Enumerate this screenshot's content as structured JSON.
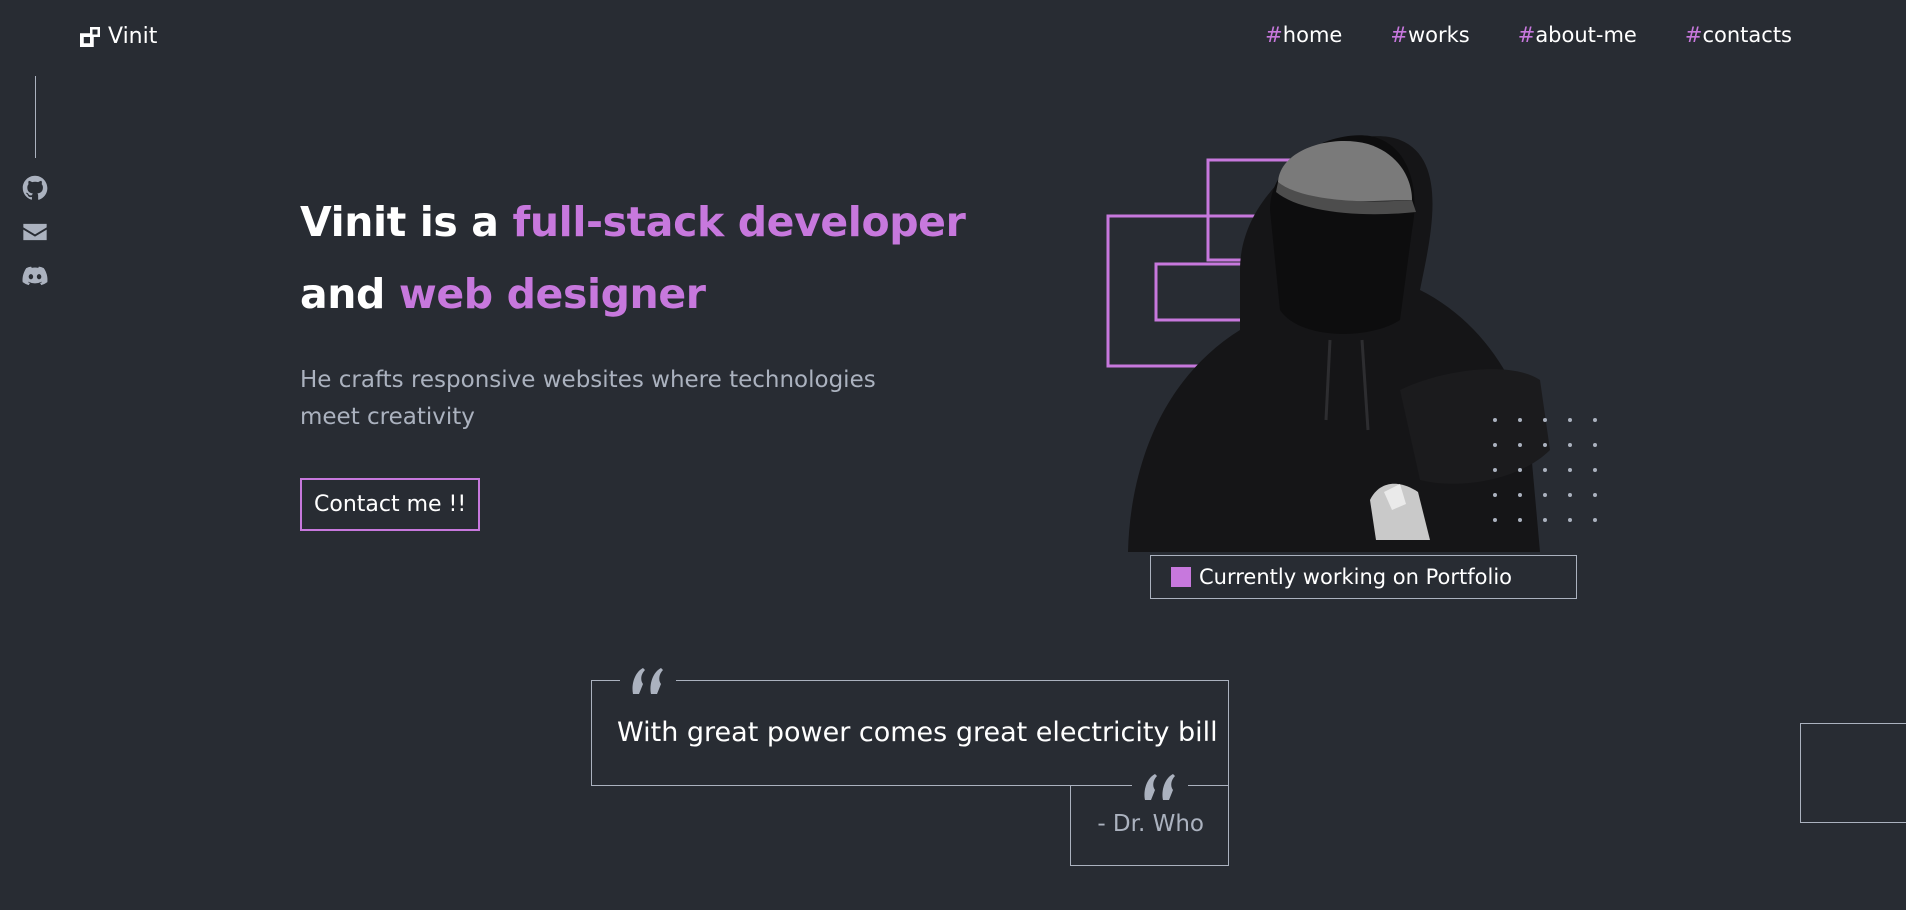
{
  "brand": {
    "name": "Vinit",
    "logo_icon": "logo-icon"
  },
  "nav": {
    "items": [
      {
        "hash": "#",
        "label": "home"
      },
      {
        "hash": "#",
        "label": "works"
      },
      {
        "hash": "#",
        "label": "about-me"
      },
      {
        "hash": "#",
        "label": "contacts"
      }
    ]
  },
  "social": {
    "icons": [
      "github-icon",
      "email-icon",
      "discord-icon"
    ]
  },
  "hero": {
    "title_parts": {
      "p1": "Vinit is a ",
      "p2": "full-stack developer",
      "p3": " and ",
      "p4": "web designer"
    },
    "subtitle": "He crafts responsive websites where technologies meet creativity",
    "cta_label": "Contact me !!"
  },
  "status": {
    "text": "Currently working on Portfolio"
  },
  "quote": {
    "text": "With great power comes great electricity bill",
    "author": "- Dr. Who"
  },
  "colors": {
    "background": "#282c33",
    "accent": "#c778dd",
    "text": "#ffffff",
    "muted": "#abb2bf"
  }
}
